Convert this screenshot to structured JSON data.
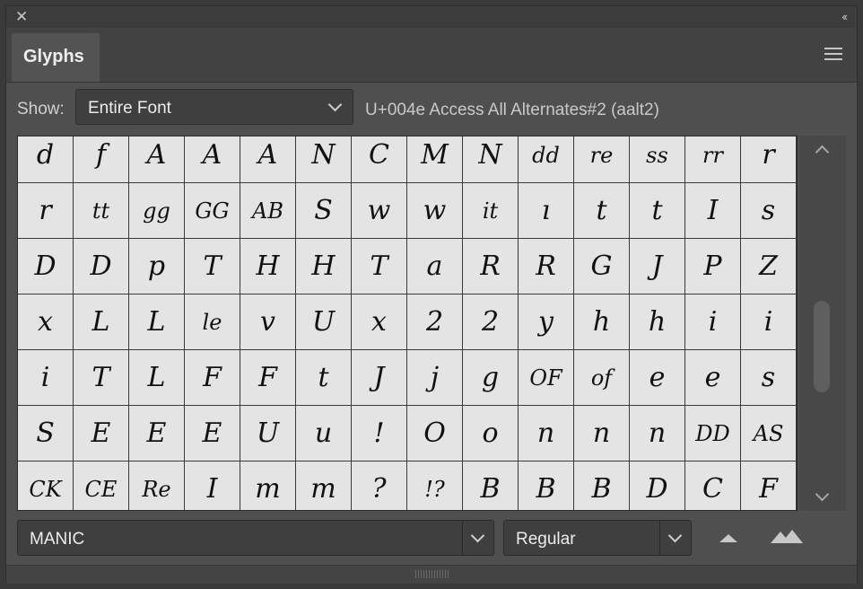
{
  "panel": {
    "close_icon": "close-icon",
    "collapse_icon": "double-chevron-icon",
    "tab_label": "Glyphs",
    "menu_icon": "hamburger-menu-icon"
  },
  "filter": {
    "show_label": "Show:",
    "show_value": "Entire Font",
    "glyph_info": "U+004e Access All Alternates#2 (aalt2)"
  },
  "glyphs": [
    [
      "d",
      "f",
      "A",
      "A",
      "A",
      "N",
      "C",
      "M",
      "N",
      "dd",
      "re",
      "ss",
      "rr",
      "r"
    ],
    [
      "r",
      "tt",
      "gg",
      "GG",
      "AB",
      "S",
      "w",
      "w",
      "it",
      "ı",
      "t",
      "t",
      "I",
      "s"
    ],
    [
      "D",
      "D",
      "p",
      "T",
      "H",
      "H",
      "T",
      "a",
      "R",
      "R",
      "G",
      "J",
      "P",
      "Z"
    ],
    [
      "x",
      "L",
      "L",
      "le",
      "v",
      "U",
      "x",
      "2",
      "2",
      "y",
      "h",
      "h",
      "i",
      "i"
    ],
    [
      "i",
      "T",
      "L",
      "F",
      "F",
      "t",
      "J",
      "j",
      "g",
      "OF",
      "of",
      "e",
      "e",
      "s"
    ],
    [
      "S",
      "E",
      "E",
      "E",
      "U",
      "u",
      "!",
      "O",
      "o",
      "n",
      "n",
      "n",
      "DD",
      "AS"
    ],
    [
      "CK",
      "CE",
      "Re",
      "I",
      "m",
      "m",
      "?",
      "!?",
      "B",
      "B",
      "B",
      "D",
      "C",
      "F"
    ]
  ],
  "footer": {
    "font_family": "MANIC",
    "font_style": "Regular",
    "zoom_out_icon": "small-mountain-icon",
    "zoom_in_icon": "large-mountains-icon"
  }
}
